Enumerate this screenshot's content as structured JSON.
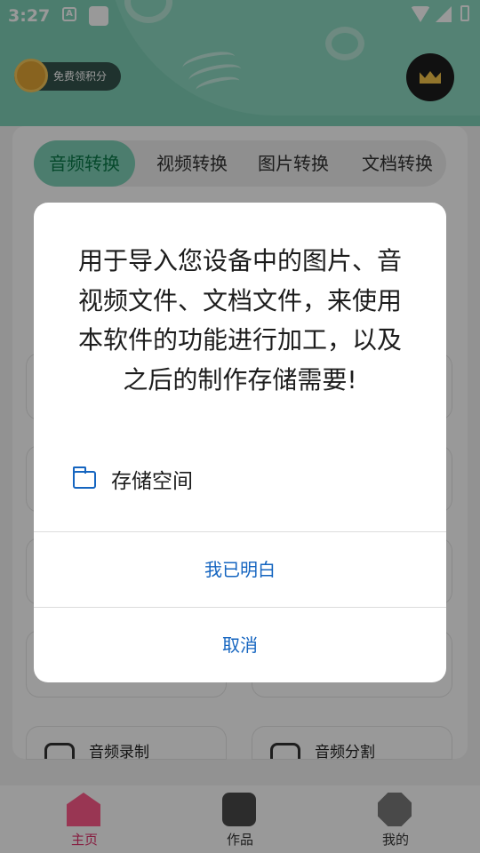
{
  "statusbar": {
    "time": "3:27",
    "a_icon": "A"
  },
  "header": {
    "points_label": "免费领积分"
  },
  "tabs": [
    {
      "label": "音频转换"
    },
    {
      "label": "视频转换"
    },
    {
      "label": "图片转换"
    },
    {
      "label": "文档转换"
    }
  ],
  "features": [
    {
      "label": "音频录制"
    },
    {
      "label": "音频分割"
    }
  ],
  "bottom_nav": [
    {
      "label": "主页"
    },
    {
      "label": "作品"
    },
    {
      "label": "我的"
    }
  ],
  "dialog": {
    "message": "用于导入您设备中的图片、音视频文件、文档文件，来使用本软件的功能进行加工，以及之后的制作存储需要!",
    "permission_label": "存储空间",
    "confirm_label": "我已明白",
    "cancel_label": "取消"
  },
  "colors": {
    "accent": "#7fd0b7",
    "dialog_button": "#1565c0",
    "home_active": "#ff5a8a"
  }
}
